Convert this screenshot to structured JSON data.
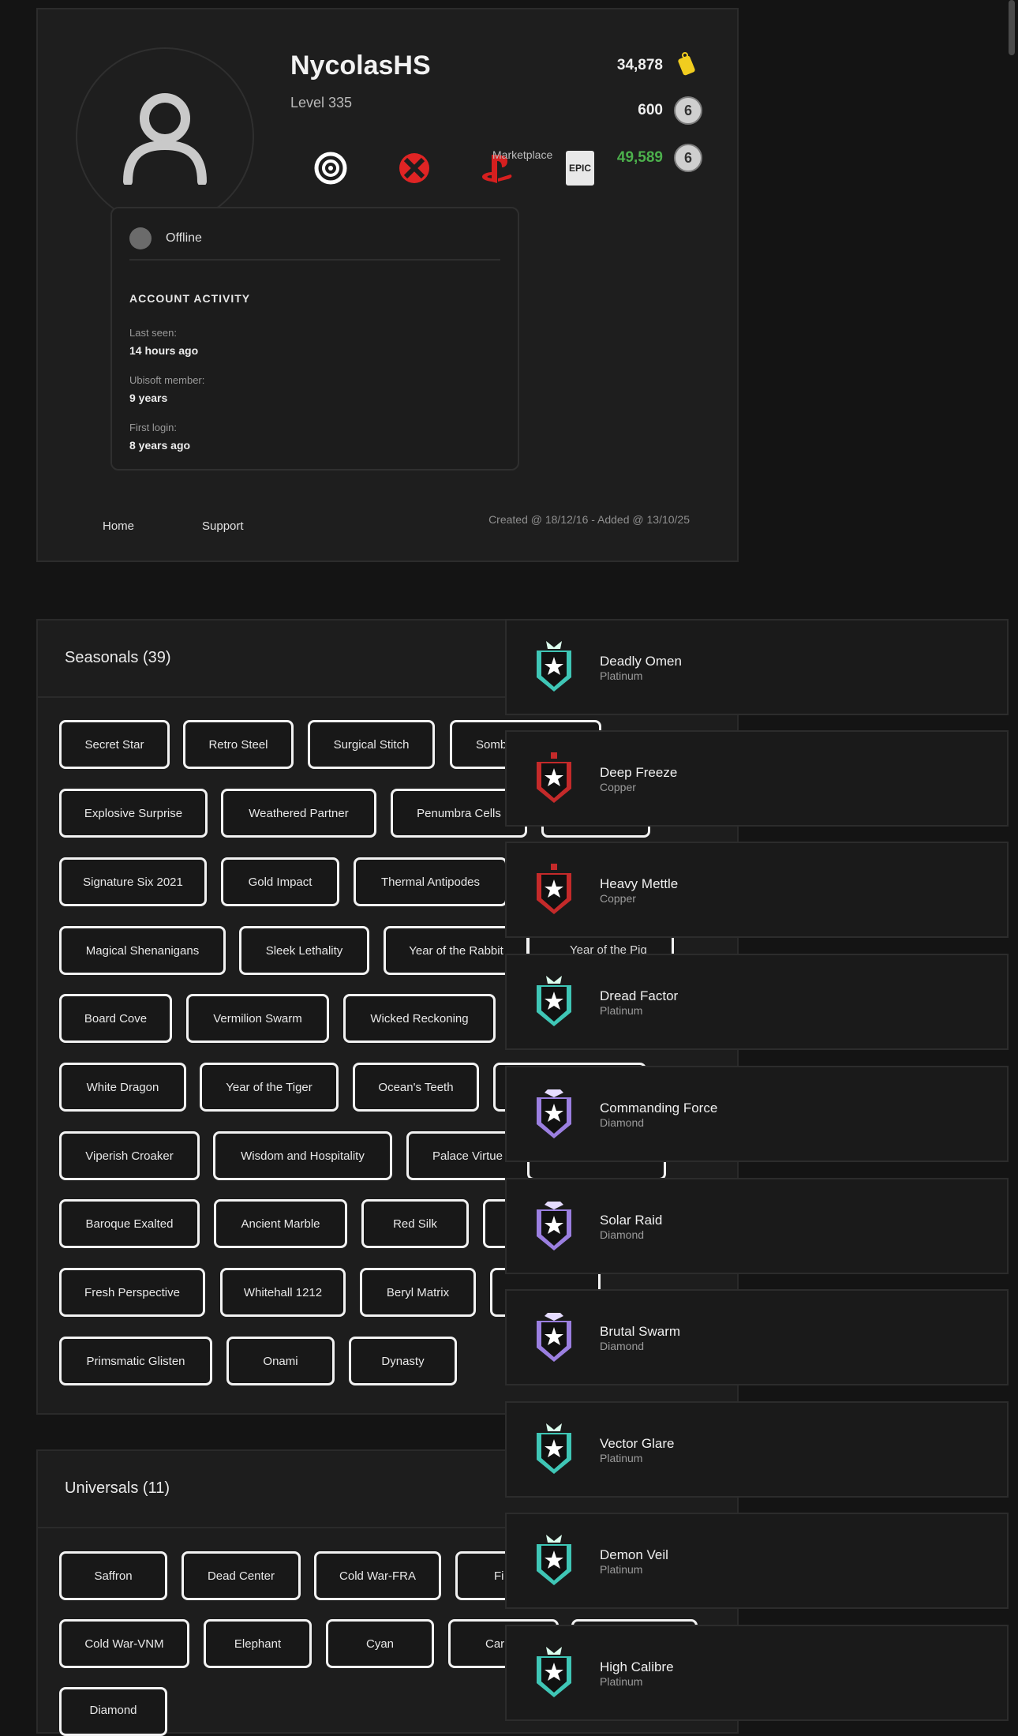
{
  "profile": {
    "username": "NycolasHS",
    "level": "Level 335",
    "status": "Offline",
    "stats": [
      {
        "value": "34,878",
        "icon": "renown-tag-icon",
        "color": "#efefef"
      },
      {
        "value": "600",
        "icon": "r6-credit-coin-icon",
        "color": "#efefef"
      },
      {
        "value": "49,589",
        "icon": "r6-credit-coin-icon",
        "color": "#4cb04c"
      }
    ],
    "marketplace_label": "Marketplace",
    "coin_glyph": "6",
    "platforms": [
      {
        "name": "ubisoft",
        "icon": "ubisoft-icon"
      },
      {
        "name": "xbox",
        "icon": "xbox-icon"
      },
      {
        "name": "playstation",
        "icon": "playstation-icon"
      },
      {
        "name": "epic",
        "icon": "epic-games-icon",
        "text": "EPIC"
      }
    ],
    "activity": {
      "title": "ACCOUNT ACTIVITY",
      "items": [
        {
          "label": "Last seen:",
          "value": "14 hours ago"
        },
        {
          "label": "Ubisoft member:",
          "value": "9 years"
        },
        {
          "label": "First login:",
          "value": "8 years ago"
        }
      ]
    },
    "footer": {
      "links": [
        "Home",
        "Support"
      ],
      "created": "Created @ 18/12/16 - Added @ 13/10/25"
    }
  },
  "seasonals": {
    "title": "Seasonals (39)",
    "tags": [
      "Secret Star",
      "Retro Steel",
      "Surgical Stitch",
      "Somb",
      "Explosive Surprise",
      "Weathered Partner",
      "Penumbra Cells",
      "Signature Six 2021",
      "Gold Impact",
      "Thermal Antipodes",
      "Magical Shenanigans",
      "Sleek Lethality",
      "Year of the Rabbit",
      "Year of the Pig",
      "Board Cove",
      "Vermilion Swarm",
      "Wicked Reckoning",
      "White Dragon",
      "Year of the Tiger",
      "Ocean's Teeth",
      "Viperish Croaker",
      "Wisdom and Hospitality",
      "Palace Virtue",
      "Baroque Exalted",
      "Ancient Marble",
      "Red Silk",
      "Fresh Perspective",
      "Whitehall 1212",
      "Beryl Matrix",
      "Primsmatic Glisten",
      "Onami",
      "Dynasty"
    ]
  },
  "universals": {
    "title": "Universals (11)",
    "tags": [
      "Saffron",
      "Dead Center",
      "Cold War-FRA",
      "Fi",
      "Cold War-VNM",
      "Elephant",
      "Cyan",
      "Car",
      "Diamond"
    ]
  },
  "ranks": [
    {
      "name": "Deadly Omen",
      "tier": "Platinum",
      "color": "#3fc6b6"
    },
    {
      "name": "Deep Freeze",
      "tier": "Copper",
      "color": "#c42a2a"
    },
    {
      "name": "Heavy Mettle",
      "tier": "Copper",
      "color": "#c42a2a"
    },
    {
      "name": "Dread Factor",
      "tier": "Platinum",
      "color": "#3fc6b6"
    },
    {
      "name": "Commanding Force",
      "tier": "Diamond",
      "color": "#9b7fe0"
    },
    {
      "name": "Solar Raid",
      "tier": "Diamond",
      "color": "#9b7fe0"
    },
    {
      "name": "Brutal Swarm",
      "tier": "Diamond",
      "color": "#9b7fe0"
    },
    {
      "name": "Vector Glare",
      "tier": "Platinum",
      "color": "#3fc6b6"
    },
    {
      "name": "Demon Veil",
      "tier": "Platinum",
      "color": "#3fc6b6"
    },
    {
      "name": "High Calibre",
      "tier": "Platinum",
      "color": "#3fc6b6"
    }
  ]
}
